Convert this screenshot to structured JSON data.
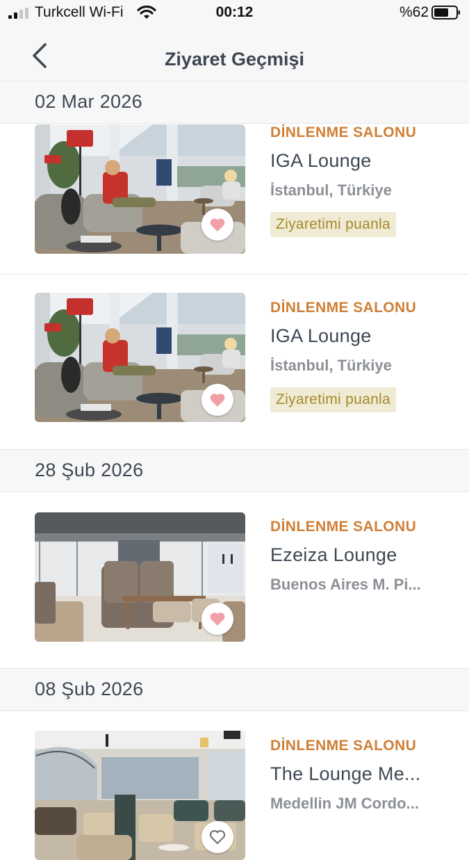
{
  "status_bar": {
    "carrier": "Turkcell Wi-Fi",
    "time": "00:12",
    "battery": "%62"
  },
  "nav": {
    "title": "Ziyaret Geçmişi",
    "back_icon": "chevron-left-icon"
  },
  "colors": {
    "accent": "#d07f36",
    "title_text": "#3d4753",
    "muted_text": "#8c9096",
    "rate_bg": "#efebd4",
    "rate_text": "#a78a2c",
    "heart": "#f2a0a8"
  },
  "sections": [
    {
      "date": "02 Mar 2026",
      "visits": [
        {
          "category": "DİNLENME SALONU",
          "name": "IGA Lounge",
          "location": "İstanbul, Türkiye",
          "rate_label": "Ziyaretimi puanla"
        },
        {
          "category": "DİNLENME SALONU",
          "name": "IGA Lounge",
          "location": "İstanbul, Türkiye",
          "rate_label": "Ziyaretimi puanla"
        }
      ]
    },
    {
      "date": "28 Şub 2026",
      "visits": [
        {
          "category": "DİNLENME SALONU",
          "name": "Ezeiza Lounge",
          "location": "Buenos Aires M. Pi..."
        }
      ]
    },
    {
      "date": "08 Şub 2026",
      "visits": [
        {
          "category": "DİNLENME SALONU",
          "name": "The Lounge Me...",
          "location": "Medellin JM Cordo..."
        }
      ]
    }
  ]
}
